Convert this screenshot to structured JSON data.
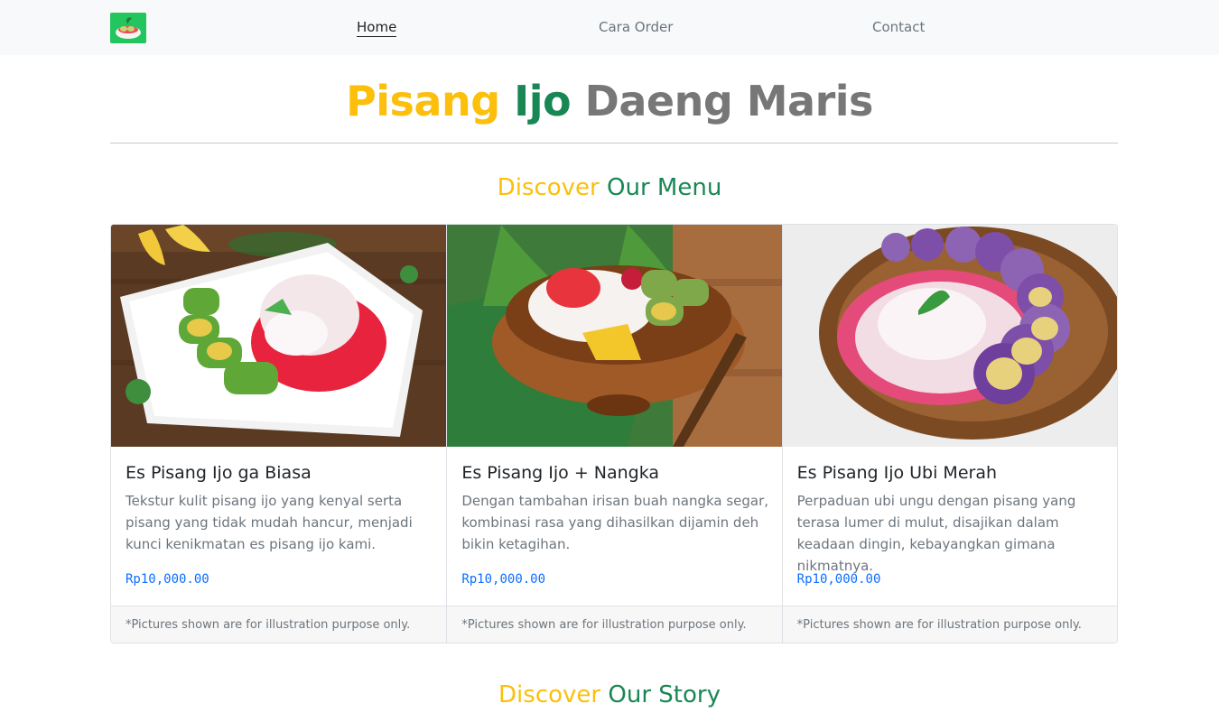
{
  "brand": {
    "logo": "pisang-ijo-bowl-logo"
  },
  "nav": [
    {
      "label": "Home",
      "active": true
    },
    {
      "label": "Cara Order",
      "active": false
    },
    {
      "label": "Contact",
      "active": false
    }
  ],
  "hero": {
    "part1": "Pisang",
    "part2": "Ijo",
    "part3": "Daeng Maris"
  },
  "menu_section": {
    "word1": "Discover",
    "word2": "Our Menu"
  },
  "cards": [
    {
      "image": "es-pisang-ijo-plate-photo",
      "title": "Es Pisang Ijo ga Biasa",
      "text": "Tekstur kulit pisang ijo yang kenyal serta pisang yang tidak mudah hancur, menjadi kunci kenikmatan es pisang ijo kami.",
      "price": "Rp10,000.00",
      "footer": "*Pictures shown are for illustration purpose only."
    },
    {
      "image": "es-pisang-ijo-nangka-bowl-photo",
      "title": "Es Pisang Ijo + Nangka",
      "text": "Dengan tambahan irisan buah nangka segar, kombinasi rasa yang dihasilkan dijamin deh bikin ketagihan.",
      "price": "Rp10,000.00",
      "footer": "*Pictures shown are for illustration purpose only."
    },
    {
      "image": "es-pisang-ijo-ubi-merah-plate-photo",
      "title": "Es Pisang Ijo Ubi Merah",
      "text": "Perpaduan ubi ungu dengan pisang yang terasa lumer di mulut, disajikan dalam keadaan dingin, kebayangkan gimana nikmatnya.",
      "price": "Rp10,000.00",
      "footer": "*Pictures shown are for illustration purpose only."
    }
  ],
  "story_section": {
    "word1": "Discover",
    "word2": "Our Story"
  },
  "colors": {
    "yellow": "#fbbf0c",
    "green": "#198754",
    "gray": "#777777",
    "price_blue": "#0d6efd"
  }
}
